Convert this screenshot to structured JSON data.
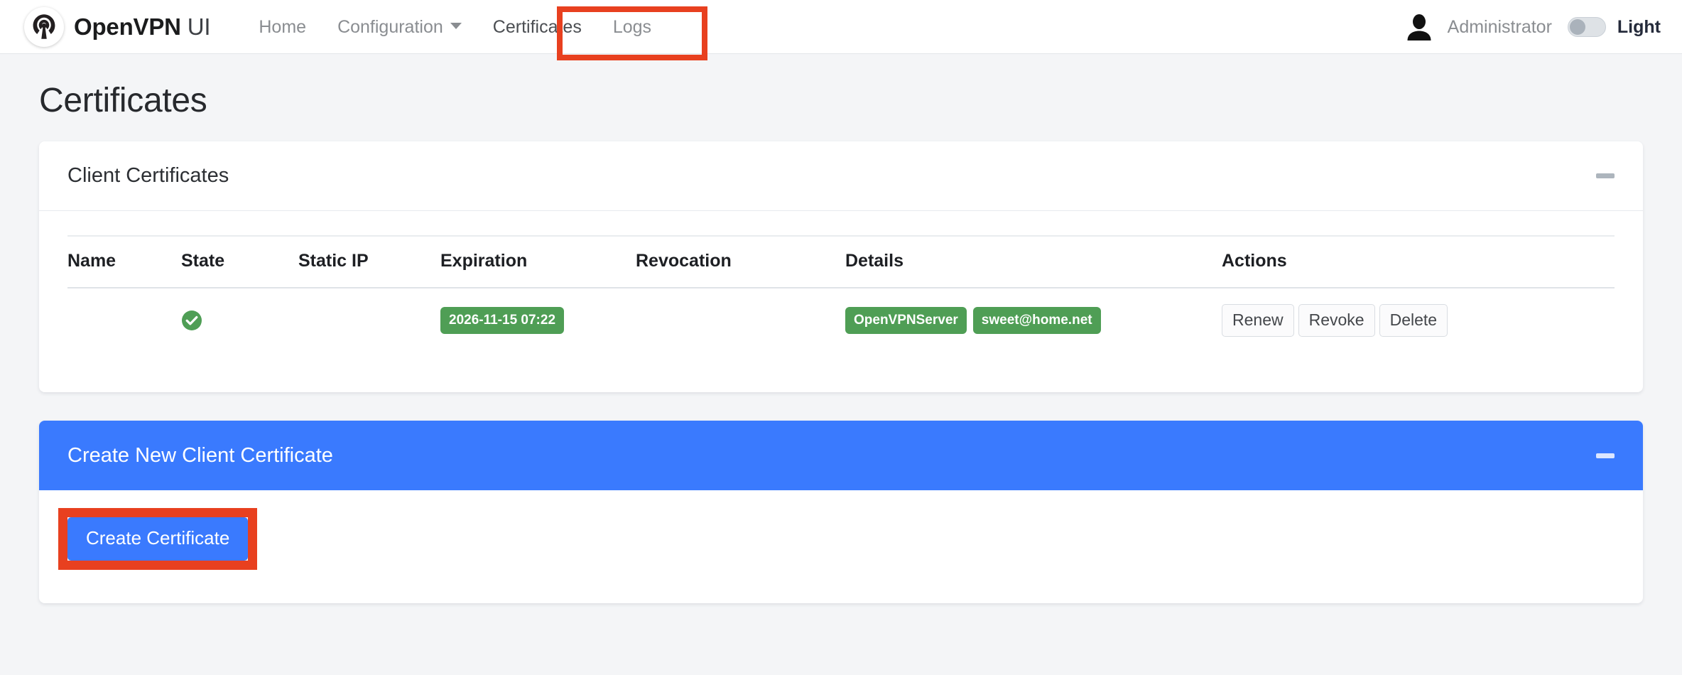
{
  "navbar": {
    "brand": {
      "bold": "OpenVPN",
      "thin": " UI",
      "logo_icon": "openvpn-logo-icon"
    },
    "links": [
      {
        "label": "Home",
        "active": false,
        "has_caret": false
      },
      {
        "label": "Configuration",
        "active": false,
        "has_caret": true
      },
      {
        "label": "Certificates",
        "active": true,
        "has_caret": false
      },
      {
        "label": "Logs",
        "active": false,
        "has_caret": false
      }
    ],
    "user": {
      "name": "Administrator",
      "avatar_icon": "user-avatar-icon"
    },
    "theme": {
      "label": "Light",
      "state": "off"
    },
    "highlight_color": "#e8401f"
  },
  "page": {
    "title": "Certificates"
  },
  "client_certificates_panel": {
    "title": "Client Certificates",
    "collapse_icon": "minus-icon",
    "columns": [
      "Name",
      "State",
      "Static IP",
      "Expiration",
      "Revocation",
      "Details",
      "Actions"
    ],
    "rows": [
      {
        "name": "",
        "state_icon": "check-circle-icon",
        "state_color": "#4f9e55",
        "static_ip": "",
        "expiration": "2026-11-15 07:22",
        "revocation": "",
        "details": [
          "OpenVPNServer",
          "sweet@home.net"
        ],
        "actions": [
          "Renew",
          "Revoke",
          "Delete"
        ]
      }
    ]
  },
  "create_panel": {
    "title": "Create New Client Certificate",
    "collapse_icon": "minus-icon",
    "header_color": "#3a7afe",
    "button_label": "Create Certificate",
    "button_highlighted": true
  }
}
